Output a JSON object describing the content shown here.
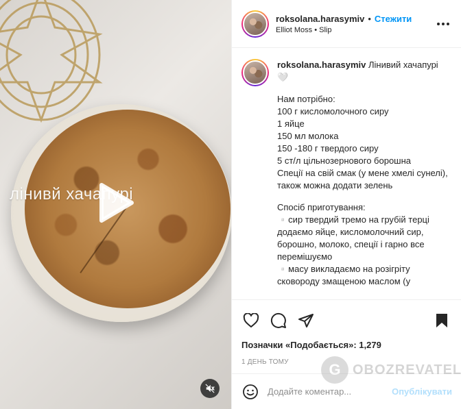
{
  "media": {
    "overlay_text": "лінивй хачапурі"
  },
  "header": {
    "username": "roksolana.harasymiv",
    "separator": "•",
    "follow_label": "Стежити",
    "music": "Elliot Moss • Slip"
  },
  "caption": {
    "username": "roksolana.harasymiv",
    "title": "Лінивий хачапурі 🤍",
    "lines": [
      "Нам потрібно:",
      "100 г кисломолочного сиру",
      "1 яйце",
      "150 мл молока",
      "150 -180 г твердого сиру",
      "5 ст/л цільнозернового борошна",
      "Спеції на свій смак (у мене хмелі сунелі), також можна додати зелень",
      "",
      "Спосіб приготування:",
      "▫️сир твердий тремо на грубій терці додаємо яйце, кисломолочний сир, борошно, молоко, спеції і гарно все перемішуємо",
      "▫️масу викладаємо на розігріту сковороду змащеною маслом (у"
    ]
  },
  "stats": {
    "likes": "Позначки «Подобається»: 1,279",
    "time": "1 ДЕНЬ ТОМУ"
  },
  "comment": {
    "placeholder": "Додайте коментар...",
    "publish_label": "Опублікувати"
  },
  "watermark": {
    "text": "OBOZREVATEL"
  }
}
